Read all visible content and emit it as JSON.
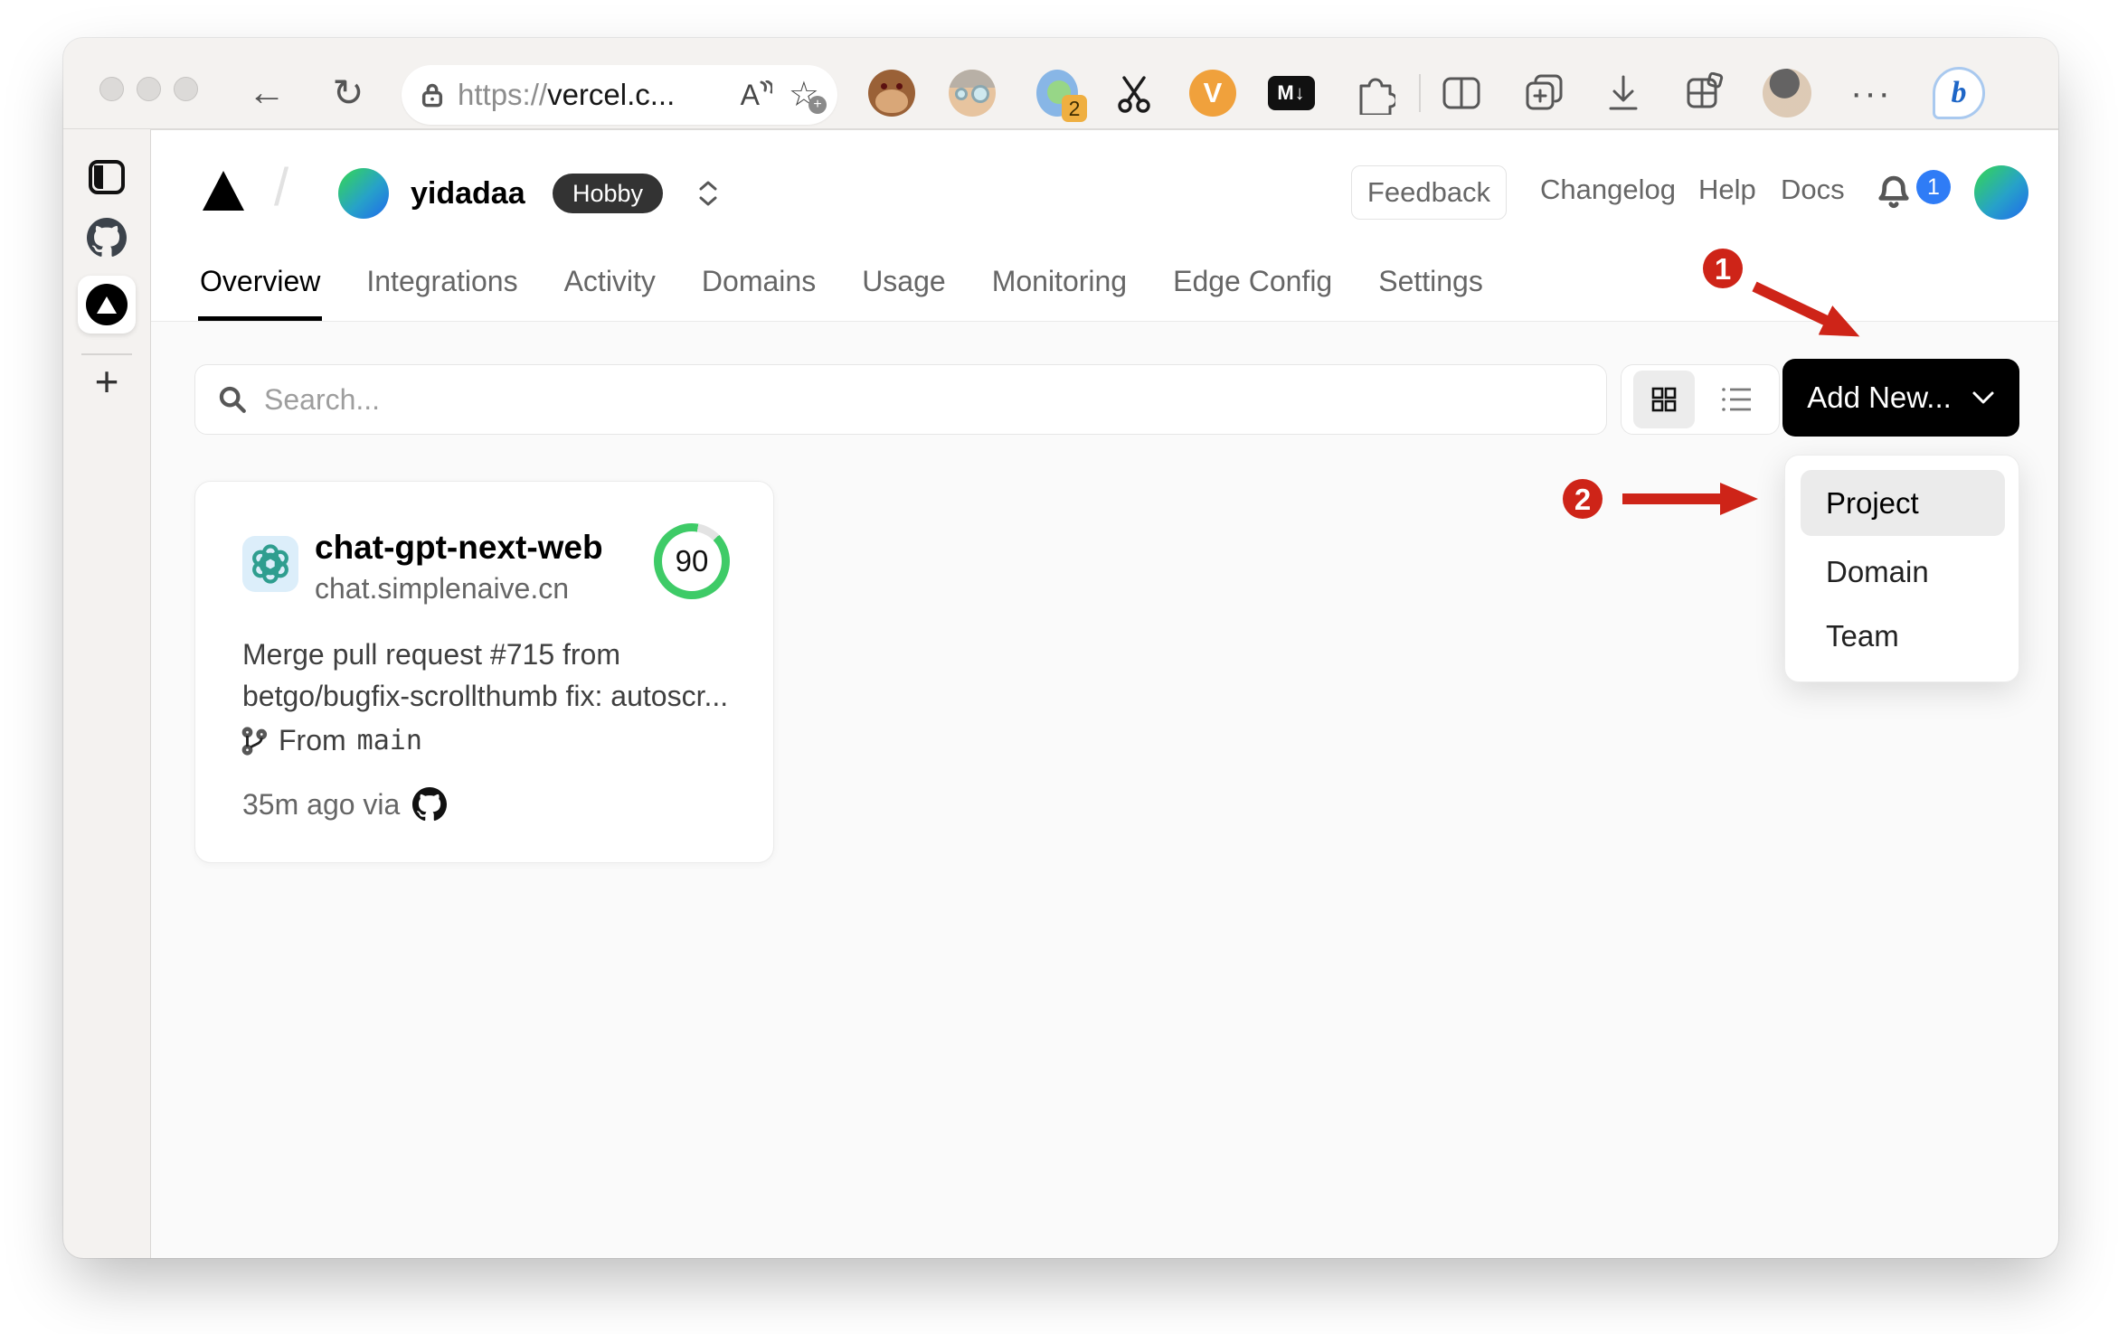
{
  "browser": {
    "url": {
      "scheme": "https://",
      "host": "vercel.c..."
    },
    "extensions_badge": "2",
    "markdown_icon_label": "M↓",
    "v_icon_label": "V",
    "bing_label": "b"
  },
  "icons": {
    "back": "←",
    "refresh": "↻",
    "star": "☆",
    "star_plus": "+",
    "more": "···",
    "sidebar_new_tab": "+",
    "slash": "/"
  },
  "vercel": {
    "team": {
      "name": "yidadaa",
      "plan": "Hobby"
    },
    "header": {
      "feedback": "Feedback",
      "changelog": "Changelog",
      "help": "Help",
      "docs": "Docs",
      "notification_count": "1"
    },
    "tabs": [
      {
        "label": "Overview"
      },
      {
        "label": "Integrations"
      },
      {
        "label": "Activity"
      },
      {
        "label": "Domains"
      },
      {
        "label": "Usage"
      },
      {
        "label": "Monitoring"
      },
      {
        "label": "Edge Config"
      },
      {
        "label": "Settings"
      }
    ],
    "toolbar": {
      "search_placeholder": "Search...",
      "add_new": "Add New..."
    },
    "project_card": {
      "title": "chat-gpt-next-web",
      "domain": "chat.simplenaive.cn",
      "score": "90",
      "commit_line1": "Merge pull request #715 from",
      "commit_line2": "betgo/bugfix-scrollthumb fix: autoscr...",
      "branch_label": "From",
      "branch_name": "main",
      "meta": "35m ago via"
    },
    "dropdown": {
      "items": [
        {
          "label": "Project"
        },
        {
          "label": "Domain"
        },
        {
          "label": "Team"
        }
      ]
    }
  },
  "annotations": {
    "step1": "1",
    "step2": "2"
  },
  "colors": {
    "annotation_red": "#ce2418",
    "score_green": "#3ecb67",
    "notification_blue": "#2f7cf6",
    "button_black": "#000000",
    "body_gray": "#fafafa"
  }
}
